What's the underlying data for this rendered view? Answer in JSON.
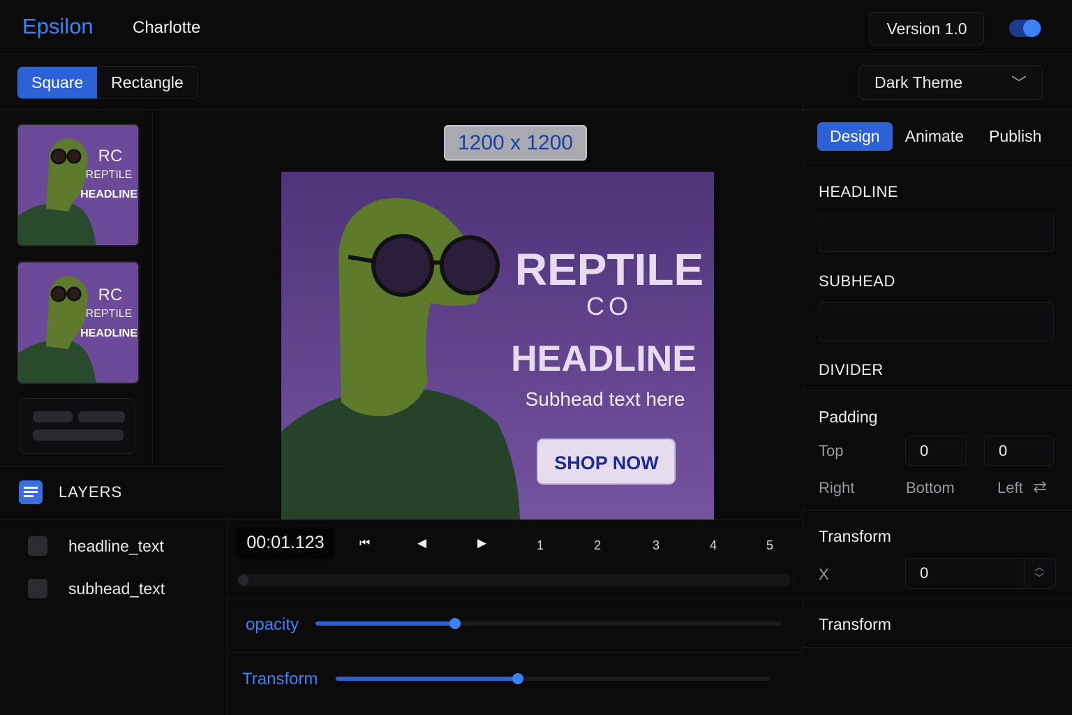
{
  "app": {
    "brand": "Epsilon",
    "user": "Charlotte",
    "version": "Version 1.0",
    "dark_mode_on": true
  },
  "shape_toggle": {
    "options": [
      "Square",
      "Rectangle"
    ],
    "selected": "Square"
  },
  "theme_select": {
    "value": "Dark Theme"
  },
  "thumbnails": [
    {
      "logo": "RC",
      "brand": "REPTILE",
      "headline": "HEADLINE"
    },
    {
      "logo": "RC",
      "brand": "REPTILE",
      "headline": "HEADLINE"
    }
  ],
  "layers": {
    "title": "LAYERS",
    "items": [
      "headline_text",
      "subhead_text"
    ]
  },
  "canvas": {
    "dimensions": "1200 x 1200",
    "brand_line1": "REPTILE",
    "brand_line2": "CO",
    "headline": "HEADLINE",
    "subhead": "Subhead text here",
    "cta": "SHOP NOW"
  },
  "timeline": {
    "time": "00:01.123",
    "frames": [
      "1",
      "2",
      "3",
      "4",
      "5"
    ],
    "sliders": [
      {
        "label": "opacity",
        "fraction": 0.3
      },
      {
        "label": "Transform",
        "fraction": 0.42
      }
    ]
  },
  "panel": {
    "tabs": [
      "Design",
      "Animate",
      "Publish"
    ],
    "active_tab": "Design",
    "sections": {
      "headline": "HEADLINE",
      "subhead": "SUBHEAD",
      "divider": "DIVIDER"
    },
    "padding": {
      "title": "Padding",
      "top_label": "Top",
      "top_value": "0",
      "top_value2": "0",
      "right_label": "Right",
      "bottom_label": "Bottom",
      "left_label": "Left"
    },
    "transform": {
      "title": "Transform",
      "x_label": "X",
      "x_value": "0"
    },
    "transform2_title": "Transform"
  },
  "colors": {
    "accent": "#3b82f6",
    "active_bg": "#2d62d6",
    "canvas_bg": "#6a4a96"
  }
}
